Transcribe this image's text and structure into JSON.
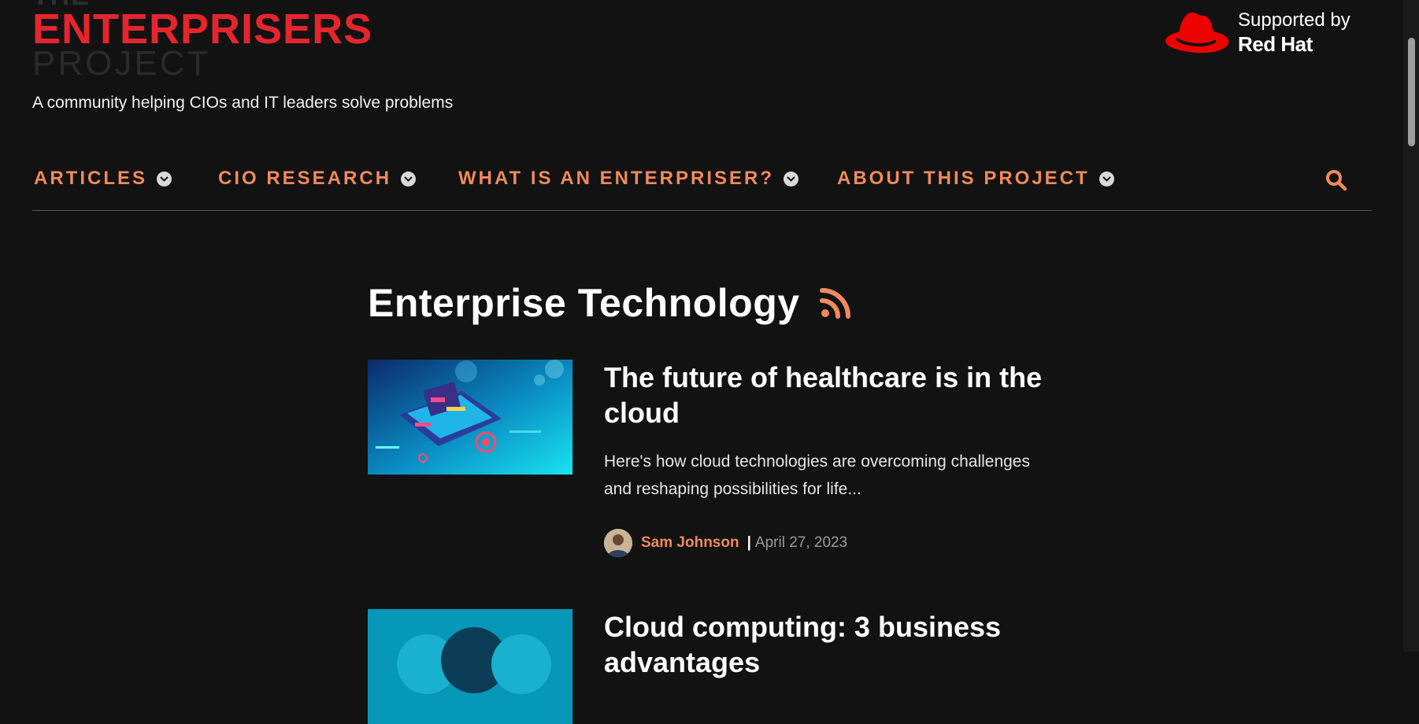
{
  "site": {
    "logo_the": "THE",
    "logo_main": "ENTERPRISERS",
    "logo_project": "PROJECT",
    "tagline": "A community helping CIOs and IT leaders solve problems",
    "sponsor_line1": "Supported by",
    "sponsor_line2": "Red Hat"
  },
  "nav": {
    "items": [
      {
        "label": "ARTICLES"
      },
      {
        "label": "CIO RESEARCH"
      },
      {
        "label": "WHAT IS AN ENTERPRISER?"
      },
      {
        "label": "ABOUT THIS PROJECT"
      }
    ],
    "search_icon": "search-icon"
  },
  "main": {
    "section_title": "Enterprise Technology",
    "rss_icon": "rss-icon",
    "articles": [
      {
        "title": "The future of healthcare is in the cloud",
        "summary": "Here's how cloud technologies are overcoming challenges and reshaping possibilities for life...",
        "author": "Sam Johnson",
        "separator": "|",
        "date": "April 27, 2023"
      },
      {
        "title": "Cloud computing: 3 business advantages"
      }
    ]
  },
  "colors": {
    "background": "#121212",
    "accent": "#f08a5d",
    "brand_red": "#e5252e",
    "text": "#ffffff",
    "muted": "#9a9a9a"
  }
}
